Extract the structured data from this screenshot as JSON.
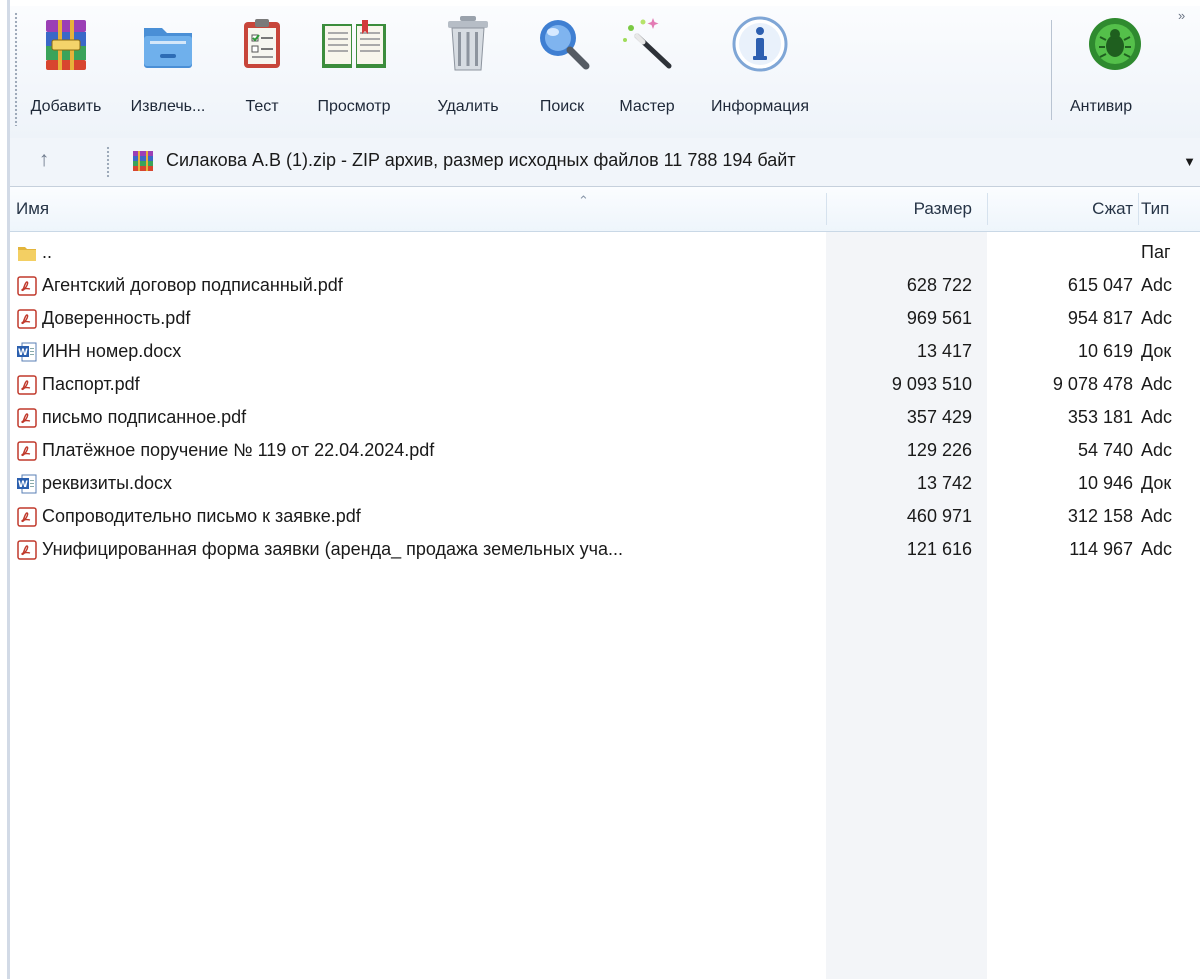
{
  "toolbar": {
    "buttons": [
      {
        "label": "Добавить",
        "icon": "winrar-add-icon"
      },
      {
        "label": "Извлечь...",
        "icon": "extract-folder-icon"
      },
      {
        "label": "Тест",
        "icon": "test-clipboard-icon"
      },
      {
        "label": "Просмотр",
        "icon": "view-book-icon"
      },
      {
        "label": "Удалить",
        "icon": "trash-can-icon"
      },
      {
        "label": "Поиск",
        "icon": "magnifier-icon"
      },
      {
        "label": "Мастер",
        "icon": "magic-wand-icon"
      },
      {
        "label": "Информация",
        "icon": "info-icon"
      },
      {
        "label": "Антивир",
        "icon": "antivirus-bug-icon"
      }
    ],
    "overflow": "»"
  },
  "address": {
    "up": "↑",
    "text": "Силакова А.В (1).zip - ZIP архив, размер исходных файлов 11 788 194 байт",
    "dropdown": "▼"
  },
  "columns": {
    "name": "Имя",
    "size": "Размер",
    "packed": "Сжат",
    "type": "Тип"
  },
  "files": [
    {
      "icon": "folder-up-icon",
      "name": "..",
      "size": "",
      "packed": "",
      "type": "Паг"
    },
    {
      "icon": "pdf-icon",
      "name": "Агентский договор подписанный.pdf",
      "size": "628 722",
      "packed": "615 047",
      "type": "Adc"
    },
    {
      "icon": "pdf-icon",
      "name": "Доверенность.pdf",
      "size": "969 561",
      "packed": "954 817",
      "type": "Adc"
    },
    {
      "icon": "word-icon",
      "name": "ИНН номер.docx",
      "size": "13 417",
      "packed": "10 619",
      "type": "Док"
    },
    {
      "icon": "pdf-icon",
      "name": "Паспорт.pdf",
      "size": "9 093 510",
      "packed": "9 078 478",
      "type": "Adc"
    },
    {
      "icon": "pdf-icon",
      "name": "письмо подписанное.pdf",
      "size": "357 429",
      "packed": "353 181",
      "type": "Adc"
    },
    {
      "icon": "pdf-icon",
      "name": "Платёжное поручение № 119 от 22.04.2024.pdf",
      "size": "129 226",
      "packed": "54 740",
      "type": "Adc"
    },
    {
      "icon": "word-icon",
      "name": "реквизиты.docx",
      "size": "13 742",
      "packed": "10 946",
      "type": "Док"
    },
    {
      "icon": "pdf-icon",
      "name": "Сопроводительно письмо к заявке.pdf",
      "size": "460 971",
      "packed": "312 158",
      "type": "Adc"
    },
    {
      "icon": "pdf-icon",
      "name": "Унифицированная форма заявки (аренда_ продажа земельных уча...",
      "size": "121 616",
      "packed": "114 967",
      "type": "Adc"
    }
  ]
}
